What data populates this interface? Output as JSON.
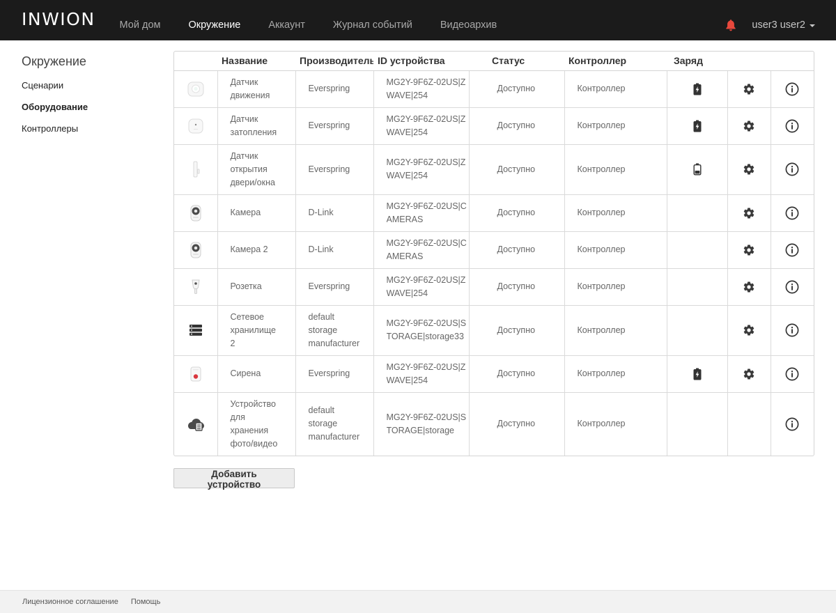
{
  "header": {
    "logo": "INWION",
    "nav": [
      {
        "label": "Мой дом",
        "active": false
      },
      {
        "label": "Окружение",
        "active": true
      },
      {
        "label": "Аккаунт",
        "active": false
      },
      {
        "label": "Журнал событий",
        "active": false
      },
      {
        "label": "Видеоархив",
        "active": false
      }
    ],
    "bell_icon": "bell-icon",
    "bell_color": "#e8483c",
    "user": "user3 user2"
  },
  "sidebar": {
    "title": "Окружение",
    "items": [
      {
        "label": "Сценарии",
        "active": false
      },
      {
        "label": "Оборудование",
        "active": true
      },
      {
        "label": "Контроллеры",
        "active": false
      }
    ]
  },
  "table": {
    "columns": [
      "",
      "Название",
      "Производитель",
      "ID устройства",
      "Статус",
      "Контроллер",
      "Заряд",
      "",
      ""
    ]
  },
  "devices": [
    {
      "icon": "motion-sensor-icon",
      "name": "Датчик движения",
      "manufacturer": "Everspring",
      "id": "MG2Y-9F6Z-02US|ZWAVE|254",
      "status": "Доступно",
      "controller": "Контроллер",
      "battery": "charging",
      "settings": true
    },
    {
      "icon": "flood-sensor-icon",
      "name": "Датчик затопления",
      "manufacturer": "Everspring",
      "id": "MG2Y-9F6Z-02US|ZWAVE|254",
      "status": "Доступно",
      "controller": "Контроллер",
      "battery": "charging",
      "settings": true
    },
    {
      "icon": "door-sensor-icon",
      "name": "Датчик открытия двери/окна",
      "manufacturer": "Everspring",
      "id": "MG2Y-9F6Z-02US|ZWAVE|254",
      "status": "Доступно",
      "controller": "Контроллер",
      "battery": "low",
      "settings": true
    },
    {
      "icon": "camera-icon",
      "name": "Камера",
      "manufacturer": "D-Link",
      "id": "MG2Y-9F6Z-02US|CAMERAS",
      "status": "Доступно",
      "controller": "Контроллер",
      "battery": null,
      "settings": true
    },
    {
      "icon": "camera-icon",
      "name": "Камера 2",
      "manufacturer": "D-Link",
      "id": "MG2Y-9F6Z-02US|CAMERAS",
      "status": "Доступно",
      "controller": "Контроллер",
      "battery": null,
      "settings": true
    },
    {
      "icon": "smart-plug-icon",
      "name": "Розетка",
      "manufacturer": "Everspring",
      "id": "MG2Y-9F6Z-02US|ZWAVE|254",
      "status": "Доступно",
      "controller": "Контроллер",
      "battery": null,
      "settings": true
    },
    {
      "icon": "network-storage-icon",
      "name": "Сетевое хранилище 2",
      "manufacturer": "default storage manufacturer",
      "id": "MG2Y-9F6Z-02US|STORAGE|storage33",
      "status": "Доступно",
      "controller": "Контроллер",
      "battery": null,
      "settings": true
    },
    {
      "icon": "siren-icon",
      "name": "Сирена",
      "manufacturer": "Everspring",
      "id": "MG2Y-9F6Z-02US|ZWAVE|254",
      "status": "Доступно",
      "controller": "Контроллер",
      "battery": "charging",
      "settings": true
    },
    {
      "icon": "cloud-storage-icon",
      "name": "Устройство для хранения фото/видео",
      "manufacturer": "default storage manufacturer",
      "id": "MG2Y-9F6Z-02US|STORAGE|storage",
      "status": "Доступно",
      "controller": "Контроллер",
      "battery": null,
      "settings": false
    }
  ],
  "add_button": "Добавить устройство",
  "footer": {
    "links": [
      "Лицензионное соглашение",
      "Помощь"
    ]
  }
}
